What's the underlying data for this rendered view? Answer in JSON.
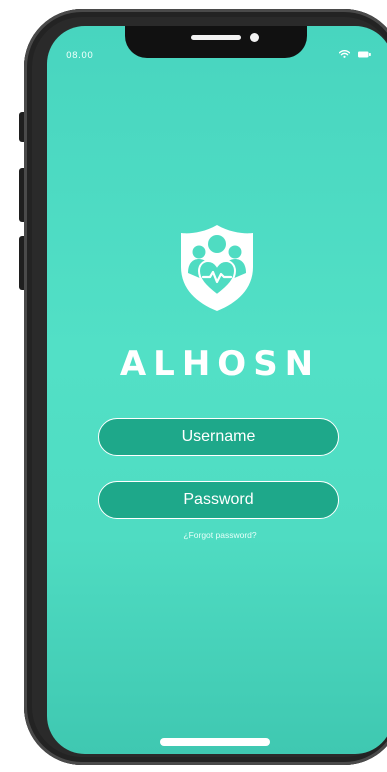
{
  "status_bar": {
    "time": "08.00",
    "icons": [
      "wifi-icon",
      "battery-icon"
    ]
  },
  "app": {
    "logo_icon": "family-heart-shield-icon",
    "brand_name": "ALHOSN"
  },
  "login": {
    "username_placeholder": "Username",
    "password_placeholder": "Password",
    "forgot_link": "¿Forgot password?"
  },
  "colors": {
    "screen_background": "#4fdcc2",
    "field_fill": "#1ea88a",
    "text": "#ffffff",
    "device_frame": "#2a2a2a"
  }
}
